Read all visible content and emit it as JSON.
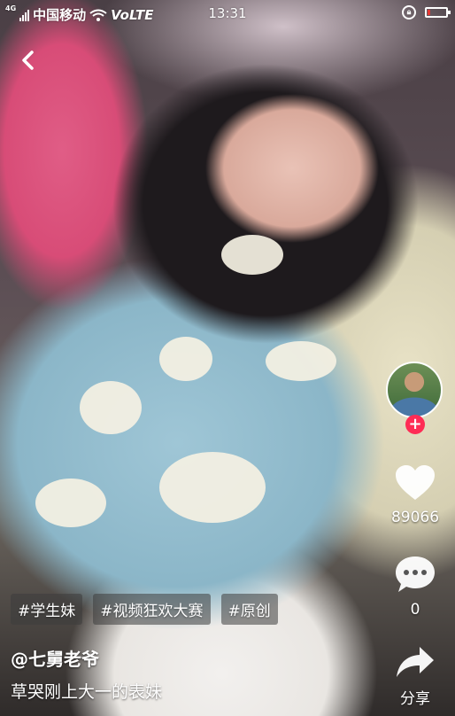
{
  "status_bar": {
    "network_type": "4G",
    "carrier": "中国移动",
    "volte": "VoLTE",
    "time": "13:31"
  },
  "rail": {
    "likes_count": "89066",
    "comments_count": "0",
    "share_label": "分享"
  },
  "hashtags": [
    "#学生妹",
    "#视频狂欢大赛",
    "#原创"
  ],
  "author": "@七舅老爷",
  "caption": "草哭刚上大一的表妹",
  "colors": {
    "follow_accent": "#fe2c55",
    "battery_low": "#e53935"
  }
}
